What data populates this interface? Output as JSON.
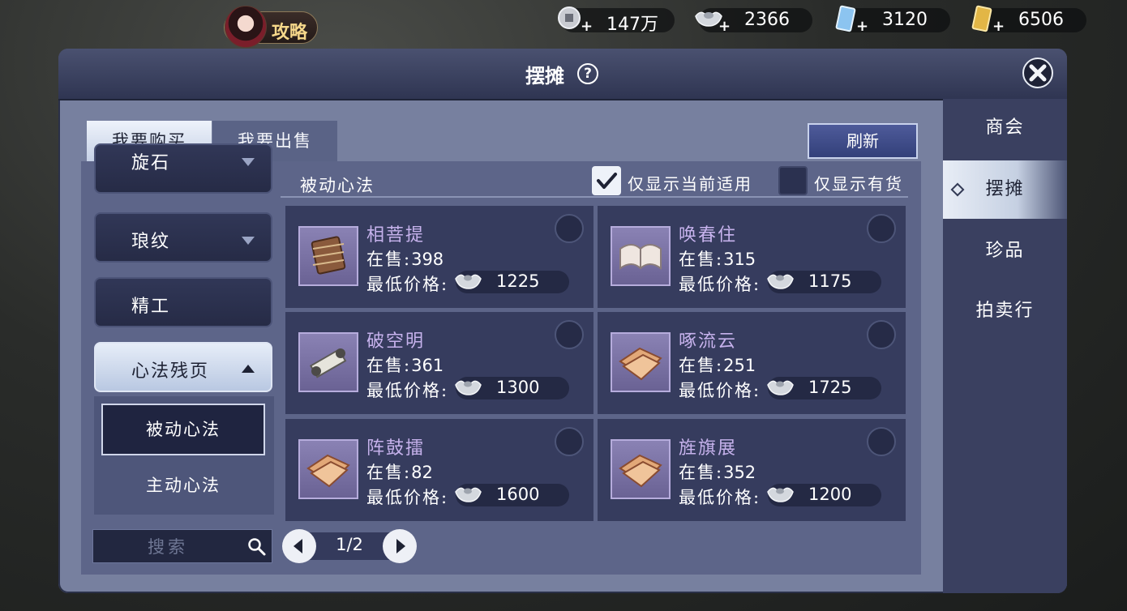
{
  "topbar": {
    "guide_label": "攻略",
    "currencies": [
      {
        "icon": "copper-coin-icon",
        "value": "147万"
      },
      {
        "icon": "silver-ingot-icon",
        "value": "2366"
      },
      {
        "icon": "blue-ticket-icon",
        "value": "3120"
      },
      {
        "icon": "gold-ticket-icon",
        "value": "6506"
      }
    ]
  },
  "window": {
    "title": "摆摊",
    "help_label": "?"
  },
  "side_tabs": [
    {
      "label": "商会",
      "active": false
    },
    {
      "label": "摆摊",
      "active": true
    },
    {
      "label": "珍品",
      "active": false
    },
    {
      "label": "拍卖行",
      "active": false
    }
  ],
  "tabs": {
    "buy": "我要购买",
    "sell": "我要出售"
  },
  "refresh_label": "刷新",
  "categories": [
    {
      "label": "旋石",
      "state": "collapsed"
    },
    {
      "label": "琅纹",
      "state": "collapsed"
    },
    {
      "label": "精工",
      "state": "none"
    },
    {
      "label": "心法残页",
      "state": "expanded"
    }
  ],
  "subcategories": [
    {
      "label": "被动心法",
      "active": true
    },
    {
      "label": "主动心法",
      "active": false
    }
  ],
  "section": {
    "title": "被动心法",
    "filter_applicable": {
      "label": "仅显示当前适用",
      "checked": true
    },
    "filter_in_stock": {
      "label": "仅显示有货",
      "checked": false
    }
  },
  "labels": {
    "stock": "在售:",
    "min_price": "最低价格:"
  },
  "items": [
    {
      "name": "相菩提",
      "stock": "398",
      "price": "1225",
      "icon": "book-bundle-icon"
    },
    {
      "name": "唤春住",
      "stock": "315",
      "price": "1175",
      "icon": "open-book-icon"
    },
    {
      "name": "破空明",
      "stock": "361",
      "price": "1300",
      "icon": "scroll-icon"
    },
    {
      "name": "啄流云",
      "stock": "251",
      "price": "1725",
      "icon": "torn-pages-icon"
    },
    {
      "name": "阵鼓擂",
      "stock": "82",
      "price": "1600",
      "icon": "torn-pages-icon"
    },
    {
      "name": "旌旗展",
      "stock": "352",
      "price": "1200",
      "icon": "torn-pages-icon"
    }
  ],
  "search": {
    "placeholder": "搜索"
  },
  "pagination": {
    "label": "1/2"
  },
  "colors": {
    "item_name": "#c6b2ec",
    "panel": "#5d6589",
    "card": "#363c5e",
    "accent_button": "#4e5b9a"
  }
}
